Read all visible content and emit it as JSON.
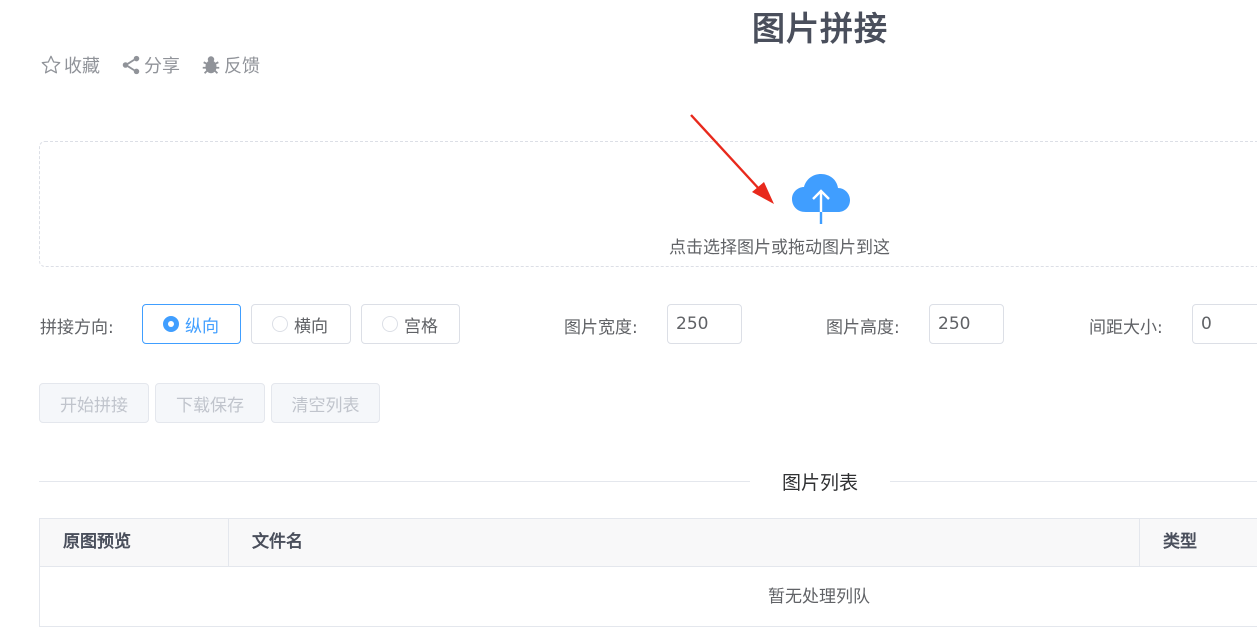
{
  "page": {
    "title": "图片拼接"
  },
  "actions": [
    {
      "label": "收藏",
      "icon": "star-icon"
    },
    {
      "label": "分享",
      "icon": "share-icon"
    },
    {
      "label": "反馈",
      "icon": "bug-icon"
    }
  ],
  "upload": {
    "text": "点击选择图片或拖动图片到这",
    "icon": "cloud-upload-icon",
    "accent": "#409eff"
  },
  "settings": {
    "direction_label": "拼接方向:",
    "direction_options": [
      {
        "label": "纵向",
        "checked": true
      },
      {
        "label": "横向",
        "checked": false
      },
      {
        "label": "宫格",
        "checked": false
      }
    ],
    "width_label": "图片宽度:",
    "width_value": "250",
    "height_label": "图片高度:",
    "height_value": "250",
    "spacing_label": "间距大小:",
    "spacing_value": "0"
  },
  "buttons": {
    "start": "开始拼接",
    "download": "下载保存",
    "clear": "清空列表"
  },
  "list": {
    "divider_title": "图片列表",
    "columns": [
      "原图预览",
      "文件名",
      "类型"
    ],
    "empty_text": "暂无处理列队"
  }
}
